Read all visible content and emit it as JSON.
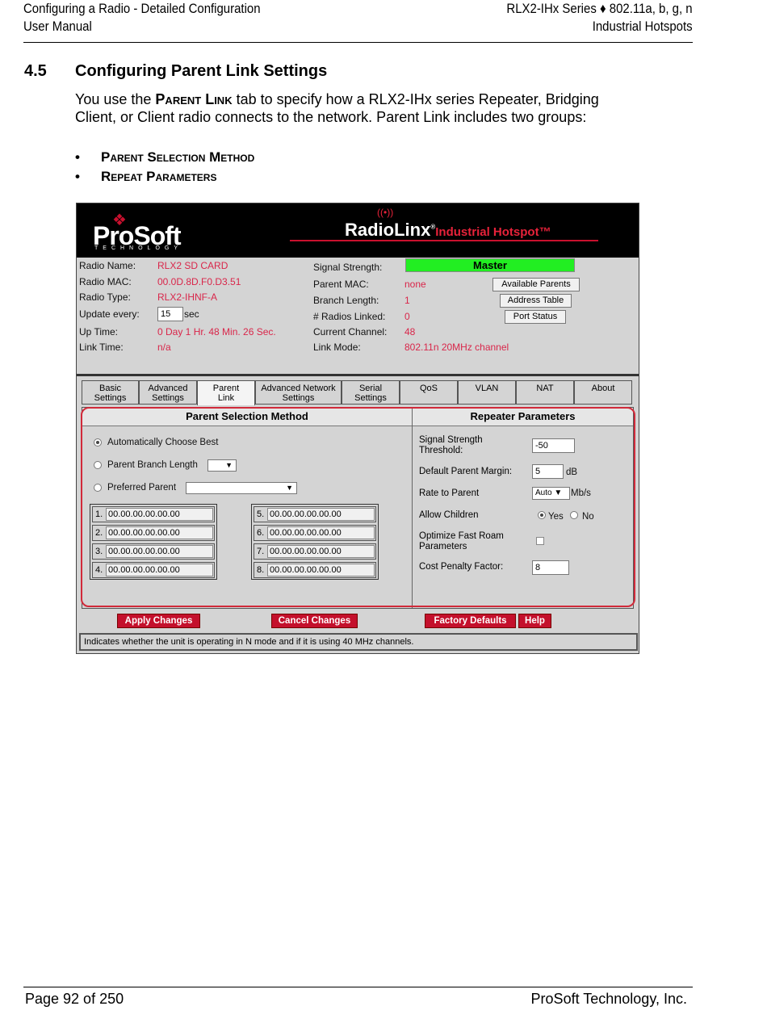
{
  "header": {
    "left_line1": "Configuring a Radio - Detailed Configuration",
    "left_line2": "User Manual",
    "right_line1": "RLX2-IHx Series ♦ 802.11a, b, g, n",
    "right_line2": "Industrial Hotspots"
  },
  "section": {
    "number": "4.5",
    "title": "Configuring Parent Link Settings",
    "intro_before": "You use the ",
    "intro_emph": "Parent Link",
    "intro_after": " tab to specify how a RLX2-IHx series Repeater, Bridging Client, or Client radio connects to the network. Parent Link includes two groups:",
    "bullets": [
      "Parent Selection Method",
      "Repeat Parameters"
    ]
  },
  "screenshot": {
    "logo": "ProSoft",
    "logo_sub": "TECHNOLOGY",
    "product": "RadioLinx",
    "product_tag": "Industrial Hotspot™",
    "status_left": [
      {
        "label": "Radio Name:",
        "value": "RLX2 SD CARD"
      },
      {
        "label": "Radio MAC:",
        "value": "00.0D.8D.F0.D3.51"
      },
      {
        "label": "Radio Type:",
        "value": "RLX2-IHNF-A"
      },
      {
        "label": "Update every:",
        "value": "15",
        "unit": "sec"
      },
      {
        "label": "Up Time:",
        "value": "0 Day 1 Hr. 48 Min. 26 Sec."
      },
      {
        "label": "Link Time:",
        "value": "n/a"
      }
    ],
    "status_right": [
      {
        "label": "Signal Strength:",
        "value": "Master"
      },
      {
        "label": "Parent MAC:",
        "value": "none"
      },
      {
        "label": "Branch Length:",
        "value": "1"
      },
      {
        "label": "# Radios Linked:",
        "value": "0"
      },
      {
        "label": "Current Channel:",
        "value": "48"
      },
      {
        "label": "Link Mode:",
        "value": "802.11n 20MHz channel"
      }
    ],
    "buttons_top": [
      "Available Parents",
      "Address Table",
      "Port Status"
    ],
    "tabs": [
      {
        "line1": "Basic",
        "line2": "Settings"
      },
      {
        "line1": "Advanced",
        "line2": "Settings"
      },
      {
        "line1": "Parent",
        "line2": "Link"
      },
      {
        "line1": "Advanced Network",
        "line2": "Settings"
      },
      {
        "line1": "Serial",
        "line2": "Settings"
      },
      {
        "line1": "QoS",
        "line2": ""
      },
      {
        "line1": "VLAN",
        "line2": ""
      },
      {
        "line1": "NAT",
        "line2": ""
      },
      {
        "line1": "About",
        "line2": ""
      }
    ],
    "active_tab": "Parent Link",
    "parent_selection": {
      "heading": "Parent Selection Method",
      "options": [
        "Automatically Choose Best",
        "Parent Branch Length",
        "Preferred Parent"
      ],
      "selected": "Automatically Choose Best",
      "macs_left": [
        {
          "n": "1.",
          "v": "00.00.00.00.00.00"
        },
        {
          "n": "2.",
          "v": "00.00.00.00.00.00"
        },
        {
          "n": "3.",
          "v": "00.00.00.00.00.00"
        },
        {
          "n": "4.",
          "v": "00.00.00.00.00.00"
        }
      ],
      "macs_right": [
        {
          "n": "5.",
          "v": "00.00.00.00.00.00"
        },
        {
          "n": "6.",
          "v": "00.00.00.00.00.00"
        },
        {
          "n": "7.",
          "v": "00.00.00.00.00.00"
        },
        {
          "n": "8.",
          "v": "00.00.00.00.00.00"
        }
      ]
    },
    "repeater": {
      "heading": "Repeater Parameters",
      "threshold_label_1": "Signal Strength",
      "threshold_label_2": "Threshold:",
      "threshold_value": "-50",
      "margin_label": "Default Parent Margin:",
      "margin_value": "5",
      "margin_unit": "dB",
      "rate_label": "Rate to Parent",
      "rate_value": "Auto",
      "rate_unit": "Mb/s",
      "children_label": "Allow Children",
      "children_yes": "Yes",
      "children_no": "No",
      "roam_label_1": "Optimize Fast Roam",
      "roam_label_2": "Parameters",
      "penalty_label": "Cost Penalty Factor:",
      "penalty_value": "8"
    },
    "actions": [
      "Apply Changes",
      "Cancel Changes",
      "Factory Defaults",
      "Help"
    ],
    "status_text": "Indicates whether the unit is operating in N mode and if it is using 40 MHz channels."
  },
  "footer": {
    "left": "Page 92 of 250",
    "right": "ProSoft Technology, Inc."
  },
  "colors": {
    "accent_red": "#c4102c",
    "value_red": "#d9264a",
    "signal_green": "#22ee22"
  }
}
